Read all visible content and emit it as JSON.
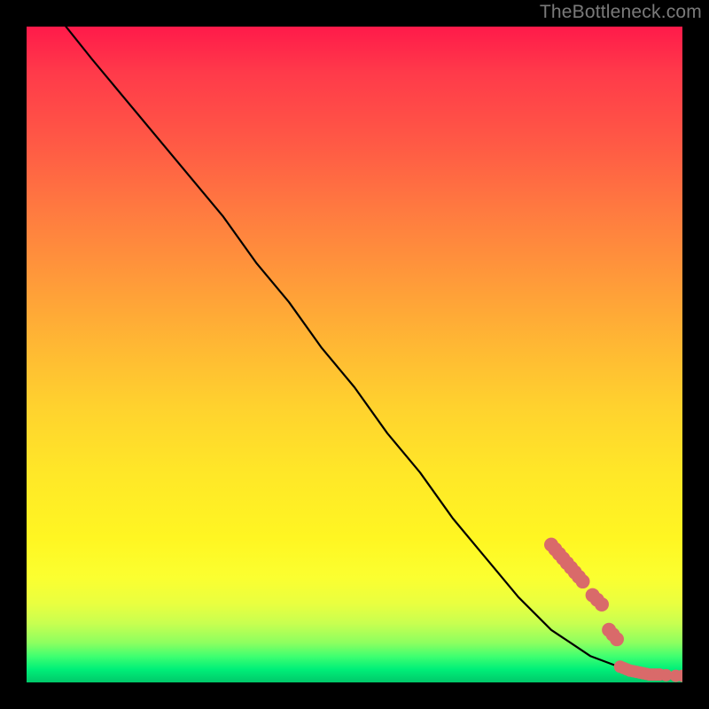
{
  "watermark": "TheBottleneck.com",
  "chart_data": {
    "type": "line",
    "title": "",
    "xlabel": "",
    "ylabel": "",
    "xlim": [
      0,
      100
    ],
    "ylim": [
      0,
      100
    ],
    "grid": false,
    "legend": false,
    "series": [
      {
        "name": "curve",
        "style": "line",
        "color": "#000000",
        "x": [
          6,
          10,
          15,
          20,
          25,
          30,
          35,
          40,
          45,
          50,
          55,
          60,
          65,
          70,
          75,
          80,
          83,
          86,
          90,
          93,
          96,
          100
        ],
        "y": [
          100,
          95,
          89,
          83,
          77,
          71,
          64,
          58,
          51,
          45,
          38,
          32,
          25,
          19,
          13,
          8,
          6,
          4,
          2.5,
          1.5,
          1,
          1
        ]
      },
      {
        "name": "points-upper-cluster",
        "style": "scatter",
        "color": "#d96a6a",
        "radius": 8,
        "x": [
          80.0,
          80.6,
          81.2,
          81.8,
          82.4,
          83.0,
          83.6,
          84.2,
          84.8
        ],
        "y": [
          21.0,
          20.3,
          19.6,
          18.9,
          18.2,
          17.5,
          16.8,
          16.1,
          15.4
        ]
      },
      {
        "name": "points-mid-cluster",
        "style": "scatter",
        "color": "#d96a6a",
        "radius": 8,
        "x": [
          86.3,
          87.0,
          87.7
        ],
        "y": [
          13.3,
          12.6,
          11.9
        ]
      },
      {
        "name": "points-lower-cluster",
        "style": "scatter",
        "color": "#d96a6a",
        "radius": 8,
        "x": [
          88.8,
          89.4,
          90.0
        ],
        "y": [
          8.0,
          7.3,
          6.6
        ]
      },
      {
        "name": "points-bottom-string",
        "style": "scatter",
        "color": "#d96a6a",
        "radius": 7,
        "x": [
          90.5,
          91.0,
          91.5,
          92.0,
          92.5,
          93.0,
          93.5,
          94.0,
          94.5,
          95.0,
          95.5,
          96.0,
          96.5,
          97.5,
          99.0,
          100.0
        ],
        "y": [
          2.4,
          2.2,
          2.0,
          1.8,
          1.7,
          1.6,
          1.5,
          1.4,
          1.3,
          1.2,
          1.2,
          1.2,
          1.2,
          1.1,
          1.0,
          1.0
        ]
      }
    ]
  }
}
